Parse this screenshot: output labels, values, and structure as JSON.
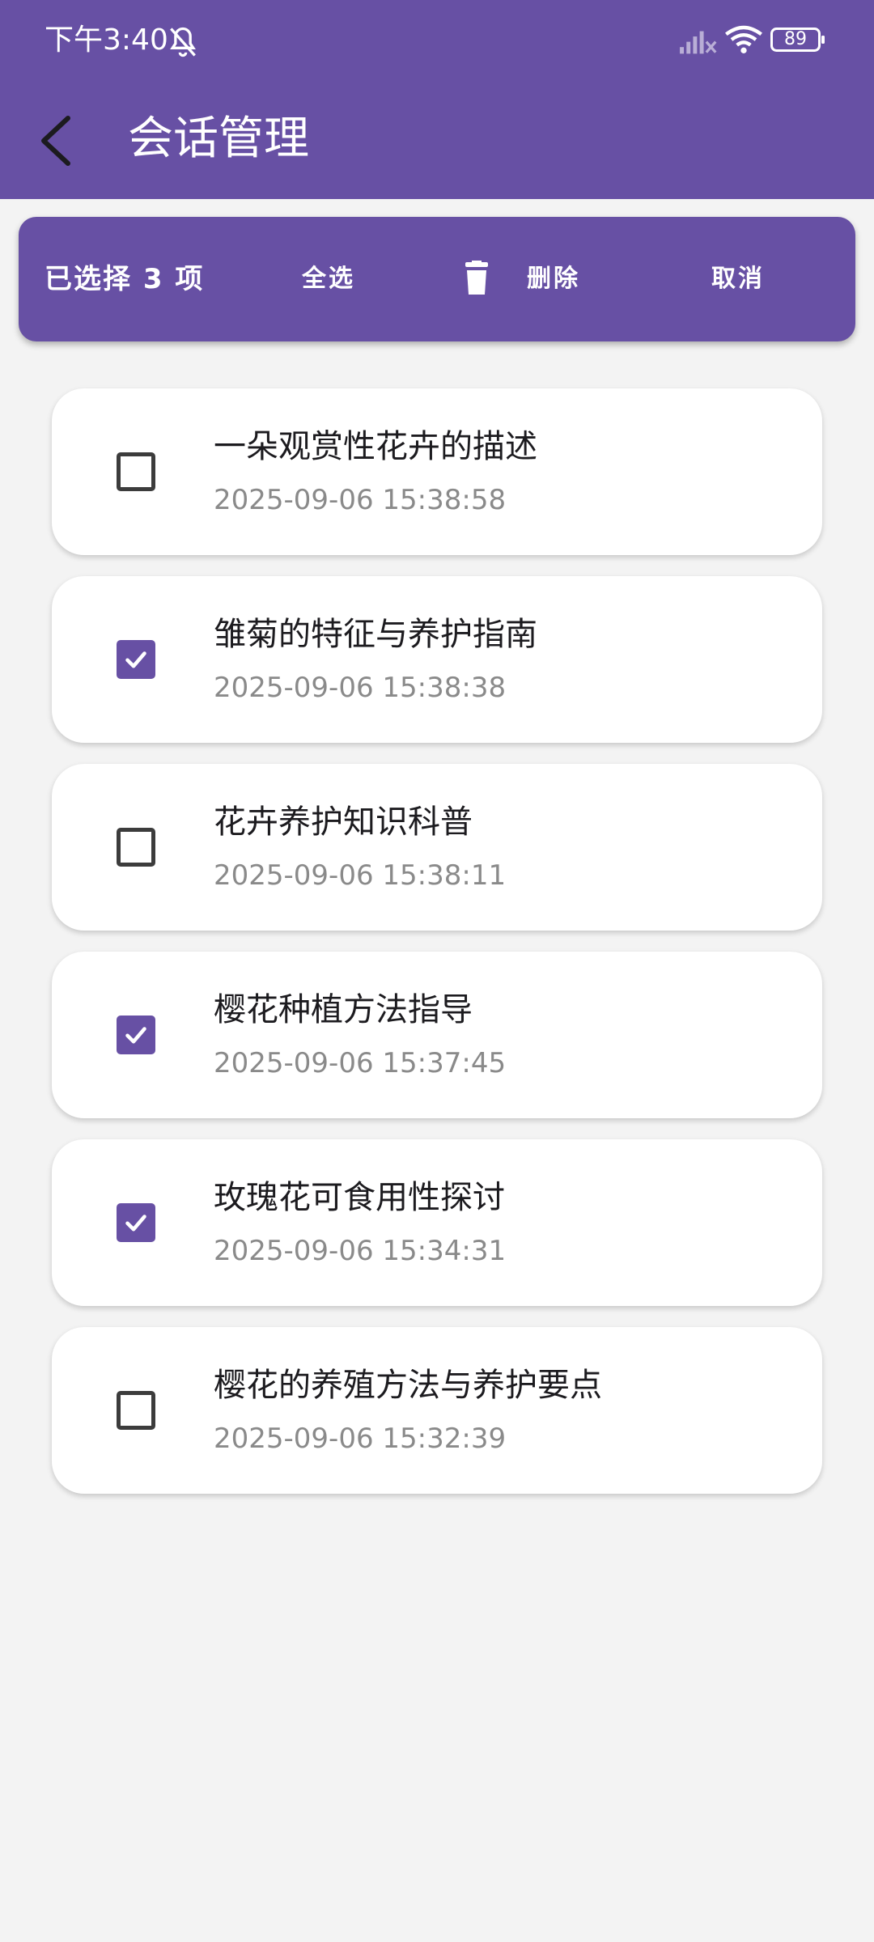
{
  "status_bar": {
    "time": "下午3:40",
    "battery": "89"
  },
  "app_bar": {
    "title": "会话管理"
  },
  "selection_bar": {
    "count_label": "已选择 3 项",
    "select_all": "全选",
    "delete": "删除",
    "cancel": "取消"
  },
  "sessions": [
    {
      "title": "一朵观赏性花卉的描述",
      "time": "2025-09-06 15:38:58",
      "checked": false
    },
    {
      "title": "雏菊的特征与养护指南",
      "time": "2025-09-06 15:38:38",
      "checked": true
    },
    {
      "title": "花卉养护知识科普",
      "time": "2025-09-06 15:38:11",
      "checked": false
    },
    {
      "title": "樱花种植方法指导",
      "time": "2025-09-06 15:37:45",
      "checked": true
    },
    {
      "title": "玫瑰花可食用性探讨",
      "time": "2025-09-06 15:34:31",
      "checked": true
    },
    {
      "title": "樱花的养殖方法与养护要点",
      "time": "2025-09-06 15:32:39",
      "checked": false
    }
  ],
  "colors": {
    "primary": "#6750a4",
    "background": "#f3f3f3",
    "timestamp": "#8a8a8a"
  }
}
